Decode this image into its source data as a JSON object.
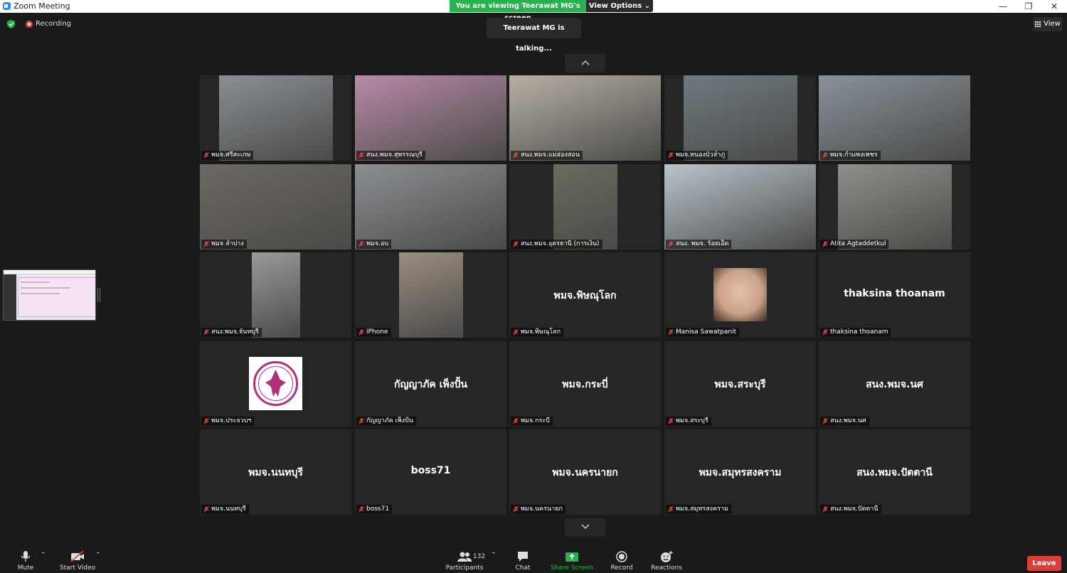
{
  "window": {
    "title": "Zoom Meeting",
    "minimize": "—",
    "maximize": "❐",
    "close": "✕"
  },
  "banner": {
    "viewing": "You are viewing Teerawat MG's screen",
    "view_options": "View Options ⌄"
  },
  "status": {
    "recording": "Recording",
    "talking": "Teerawat MG is talking...",
    "view": "View"
  },
  "tiles": [
    {
      "label": "พมจ.ศรีสะเกษ",
      "kind": "video",
      "bg": "#8a8f95"
    },
    {
      "label": "สนง.พมจ.สุพรรณบุรี",
      "kind": "video",
      "bg": "#b98aa8"
    },
    {
      "label": "สนง.พมจ.แม่ฮ่องสอน",
      "kind": "video",
      "bg": "#b7b0a6"
    },
    {
      "label": "พมจ.หนองบัวลำภู",
      "kind": "video",
      "bg": "#6f7a80"
    },
    {
      "label": "พมจ.กำแพงเพชร",
      "kind": "video",
      "bg": "#88929a"
    },
    {
      "label": "พมจ ลำปาง",
      "kind": "video",
      "bg": "#6d6863"
    },
    {
      "label": "พมจ.อบ",
      "kind": "video",
      "bg": "#8c8f93"
    },
    {
      "label": "สนง.พมจ.อุดรธานี (การเงิน)",
      "kind": "video",
      "bg": "#6a6c5e"
    },
    {
      "label": "สนง. พมจ. ร้อยเอ็ด",
      "kind": "video",
      "bg": "#b9c4cc"
    },
    {
      "label": "Atita Agtaddetkul",
      "kind": "video",
      "bg": "#8f8f8a"
    },
    {
      "label": "สนง.พมจ.จันทบุรี",
      "kind": "video",
      "bg": "#9a9a98"
    },
    {
      "label": "iPhone",
      "kind": "video",
      "bg": "#9c8e80"
    },
    {
      "label": "พมจ.พิษณุโลก",
      "kind": "name",
      "name": "พมจ.พิษณุโลก"
    },
    {
      "label": "Manisa Sawatpanit",
      "kind": "avatar",
      "bg": "#caa189"
    },
    {
      "label": "thaksina thoanam",
      "kind": "name",
      "name": "thaksina thoanam"
    },
    {
      "label": "พมจ.ประจวบฯ",
      "kind": "logo"
    },
    {
      "label": "กัญญาภัค เพ็งปั้น",
      "kind": "name",
      "name": "กัญญาภัค เพ็งปั้น"
    },
    {
      "label": "พมจ.กระบี่",
      "kind": "name",
      "name": "พมจ.กระบี่"
    },
    {
      "label": "พมจ.สระบุรี",
      "kind": "name",
      "name": "พมจ.สระบุรี"
    },
    {
      "label": "สนง.พมจ.นศ",
      "kind": "name",
      "name": "สนง.พมจ.นศ"
    },
    {
      "label": "พมจ.นนทบุรี",
      "kind": "name",
      "name": "พมจ.นนทบุรี"
    },
    {
      "label": "boss71",
      "kind": "name",
      "name": "boss71"
    },
    {
      "label": "พมจ.นครนายก",
      "kind": "name",
      "name": "พมจ.นครนายก"
    },
    {
      "label": "พมจ.สมุทรสงคราม",
      "kind": "name",
      "name": "พมจ.สมุทรสงคราม"
    },
    {
      "label": "สนง.พมจ.ปัตตานี",
      "kind": "name",
      "name": "สนง.พมจ.ปัตตานี"
    }
  ],
  "toolbar": {
    "mute": "Mute",
    "start_video": "Start Video",
    "participants": "Participants",
    "participant_count": "132",
    "chat": "Chat",
    "share_screen": "Share Screen",
    "record": "Record",
    "reactions": "Reactions",
    "leave": "Leave"
  },
  "colors": {
    "share_green": "#25b34b",
    "leave_red": "#d9403a",
    "tile_bg": "#262626"
  }
}
